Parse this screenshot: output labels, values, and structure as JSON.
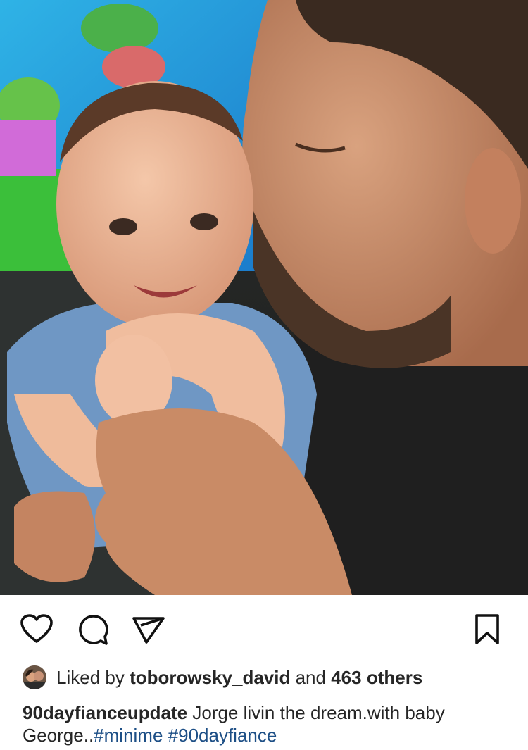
{
  "post": {
    "image": {
      "subject": "photo-man-kissing-baby"
    },
    "actions": {
      "like_icon": "heart-icon",
      "comment_icon": "comment-icon",
      "share_icon": "send-icon",
      "save_icon": "bookmark-icon"
    },
    "likes": {
      "prefix": "Liked by",
      "user": "toborowsky_david",
      "conjunction": "and",
      "others": "463 others"
    },
    "caption": {
      "username": "90dayfianceupdate",
      "text": "Jorge livin the dream.with baby George..",
      "hashtags": [
        "#minime",
        "#90dayfiance"
      ]
    }
  },
  "colors": {
    "text": "#262626",
    "hashtag": "#1d4f86",
    "background": "#ffffff"
  }
}
